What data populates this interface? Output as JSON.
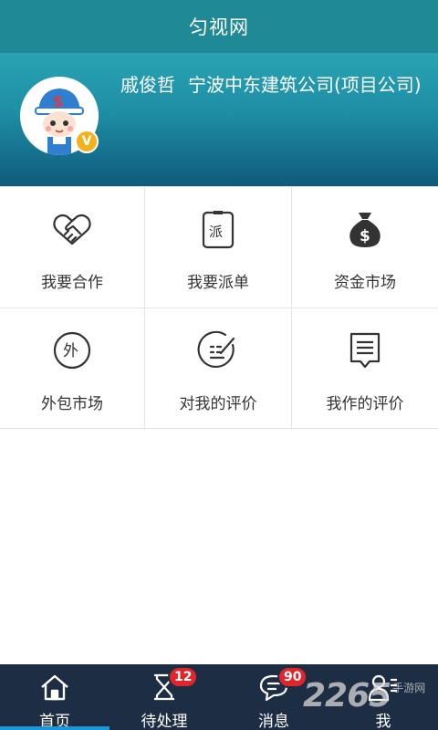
{
  "app_bar": {
    "title": "匀视网"
  },
  "profile": {
    "name": "戚俊哲",
    "company": "宁波中东建筑公司(项目公司)",
    "verified_badge": "V",
    "avatar_icon": "worker-avatar-icon"
  },
  "menu": [
    {
      "label": "我要合作",
      "icon": "handshake-icon"
    },
    {
      "label": "我要派单",
      "icon": "dispatch-order-icon"
    },
    {
      "label": "资金市场",
      "icon": "money-bag-icon"
    },
    {
      "label": "外包市场",
      "icon": "outsource-icon"
    },
    {
      "label": "对我的评价",
      "icon": "rating-pen-icon"
    },
    {
      "label": "我作的评价",
      "icon": "comment-icon"
    }
  ],
  "tabbar": {
    "items": [
      {
        "label": "首页",
        "icon": "home-icon",
        "active": true
      },
      {
        "label": "待处理",
        "icon": "hourglass-icon",
        "badge": "12"
      },
      {
        "label": "消息",
        "icon": "message-icon",
        "badge": "90"
      },
      {
        "label": "我",
        "icon": "user-icon"
      }
    ]
  },
  "watermark": {
    "number": "2265",
    "text": "手游网"
  },
  "colors": {
    "header": "#1f8a95",
    "tabbar": "#1d2d43",
    "badge": "#e0262b",
    "active_indicator": "#1e97d6",
    "verified": "#f2b21b"
  }
}
